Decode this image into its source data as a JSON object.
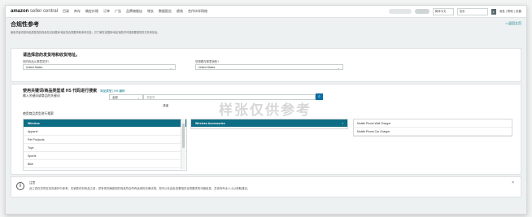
{
  "topbar": {
    "logo": "amazon",
    "logo_sub": "seller central",
    "nav": [
      "目录",
      "库存",
      "确定价格",
      "订单",
      "广告",
      "品牌旗舰店",
      "增长",
      "数据报告",
      "绩效",
      "合作伙伴网络"
    ],
    "language": "简体中文",
    "search_placeholder": "搜索",
    "links": "消息 | 帮助 | 设置"
  },
  "header": {
    "title": "合规性参考",
    "description": "使用关键词或商品类型查找商品在目标国家/地区的合规要求和参考信息，并了解在该国家/地区销售时可能需要提供的文件和信息。",
    "back_link": "< 返回主页"
  },
  "country_panel": {
    "title": "请选择您的发货地和收货地址。",
    "from_label": "您的商品从哪里发货?",
    "from_value": "United States",
    "to_label": "您想要在哪里销售?",
    "to_value": "United States"
  },
  "search_panel": {
    "title": "使用关键词/商品类型或 HS 代码进行搜索",
    "subtitle_links": "商品类型 | HS 编码",
    "keyword_label": "输入关键词或商品的关键词",
    "keyword_type": "全部",
    "keyword_placeholder": "关键词",
    "or_label": "或者",
    "browse_label": "使用商品类型进行搜索",
    "categories": [
      {
        "label": "Wireless",
        "active": true
      },
      {
        "label": "Apparel",
        "active": false
      },
      {
        "label": "Pet Products",
        "active": false
      },
      {
        "label": "Toys",
        "active": false
      },
      {
        "label": "Sports",
        "active": false
      },
      {
        "label": "Bike",
        "active": false
      }
    ],
    "subcategories": [
      {
        "label": "Wireless Accessories",
        "active": true
      }
    ],
    "results": [
      "Mobile Phone Wall Charger",
      "Mobile Phone Car Charger"
    ]
  },
  "watermark": "样张仅供参考",
  "note": {
    "title": "注意",
    "text": "此工具仅供您在实际操作中参考。在销售任何商品之前，您有责任确保您的商品符合所有适用的法律法规。您可以在此处查看相关合规要求的详细信息，并咨询专业人士以获取建议。"
  }
}
